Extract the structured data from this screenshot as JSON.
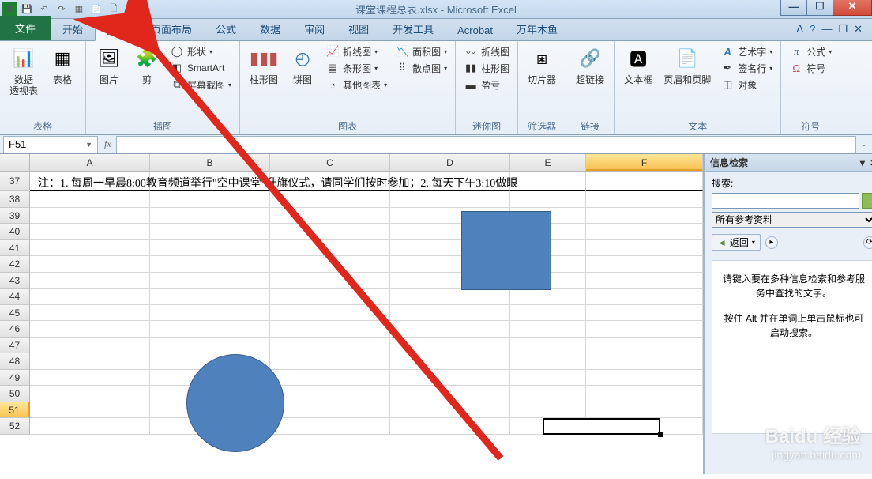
{
  "window": {
    "title": "课堂课程总表.xlsx - Microsoft Excel"
  },
  "tabs": {
    "file": "文件",
    "items": [
      "开始",
      "插入",
      "页面布局",
      "公式",
      "数据",
      "审阅",
      "视图",
      "开发工具",
      "Acrobat",
      "万年木鱼"
    ],
    "active_index": 1
  },
  "ribbon": {
    "group_tables": {
      "label": "表格",
      "pivot": "数据\n透视表",
      "table": "表格"
    },
    "group_illus": {
      "label": "插图",
      "picture": "图片",
      "clip": "剪",
      "shapes": "形状",
      "smartart": "SmartArt",
      "screenshot": "屏幕截图"
    },
    "group_charts": {
      "label": "图表",
      "column": "柱形图",
      "pie": "饼图",
      "line": "折线图",
      "area": "面积图",
      "bar": "条形图",
      "scatter": "散点图",
      "other": "其他图表"
    },
    "group_spark": {
      "label": "迷你图",
      "line": "折线图",
      "column": "柱形图",
      "winloss": "盈亏"
    },
    "group_filter": {
      "label": "筛选器",
      "slicer": "切片器"
    },
    "group_links": {
      "label": "链接",
      "hyperlink": "超链接"
    },
    "group_text": {
      "label": "文本",
      "textbox": "文本框",
      "headerfooter": "页眉和页脚",
      "wordart": "艺术字",
      "sigline": "签名行",
      "object": "对象"
    },
    "group_symbols": {
      "label": "符号",
      "equation": "公式",
      "symbol": "符号"
    }
  },
  "formula_bar": {
    "cell_ref": "F51"
  },
  "grid": {
    "columns": [
      "A",
      "B",
      "C",
      "D",
      "E",
      "F"
    ],
    "active_col": "F",
    "row_start": 37,
    "row_end": 52,
    "active_row": 51,
    "note": "注：1. 每周一早晨8:00教育频道举行\"空中课堂\"升旗仪式，请同学们按时参加；2. 每天下午3:10做眼"
  },
  "pane": {
    "title": "信息检索",
    "search_label": "搜索:",
    "dropdown": "所有参考资料",
    "back": "返回",
    "hint1": "请键入要在多种信息检索和参考服务中查找的文字。",
    "hint2": "按住 Alt 并在单词上单击鼠标也可启动搜索。"
  },
  "watermark": {
    "brand": "Baidu 经验",
    "url": "jingyan.baidu.com"
  }
}
